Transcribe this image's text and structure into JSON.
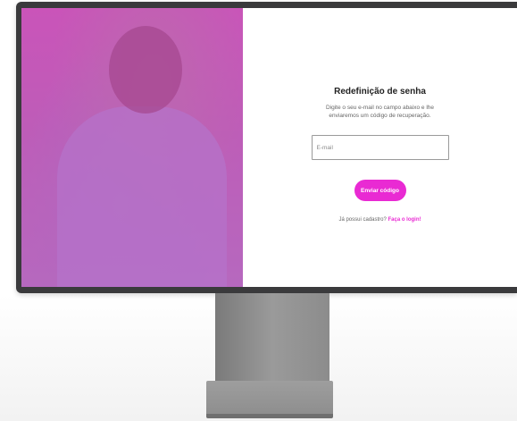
{
  "form": {
    "title": "Redefinição de senha",
    "description": "Digite o seu e-mail no campo abaixo e lhe enviaremos um código de recuperação.",
    "email_placeholder": "E-mail",
    "submit_label": "Enviar código",
    "login_prompt": "Já possui cadastro?",
    "login_link": "Faça o login!"
  },
  "colors": {
    "accent": "#e92ad3",
    "bezel": "#3a3a3c",
    "stand": "#8f8f8f"
  },
  "photo": {
    "description_icon": "person-photo"
  }
}
